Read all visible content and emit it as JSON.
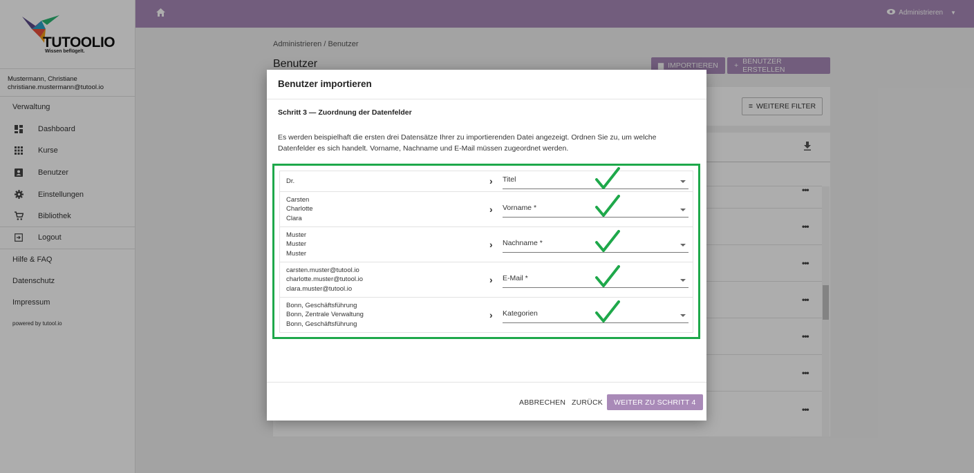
{
  "brand": {
    "name": "TUTOOLIO",
    "tagline": "Wissen beflügelt."
  },
  "user": {
    "name": "Mustermann, Christiane",
    "email": "christiane.mustermann@tutool.io"
  },
  "sidebar": {
    "section_admin": "Verwaltung",
    "items": [
      {
        "label": "Dashboard",
        "icon": "dashboard-icon"
      },
      {
        "label": "Kurse",
        "icon": "grid-icon"
      },
      {
        "label": "Benutzer",
        "icon": "user-icon"
      },
      {
        "label": "Einstellungen",
        "icon": "gear-icon"
      },
      {
        "label": "Bibliothek",
        "icon": "cart-icon"
      },
      {
        "label": "Logout",
        "icon": "logout-icon"
      }
    ],
    "links": [
      "Hilfe & FAQ",
      "Datenschutz",
      "Impressum"
    ],
    "powered": "powered by tutool.io"
  },
  "topbar": {
    "admin_label": "Administrieren"
  },
  "page": {
    "breadcrumb": "Administrieren  /  Benutzer",
    "title": "Benutzer",
    "import_label": "IMPORTIEREN",
    "create_label": "BENUTZER ERSTELLEN",
    "filter_label": "WEITERE FILTER"
  },
  "modal": {
    "title": "Benutzer importieren",
    "step": "Schritt 3 — Zuordnung der Datenfelder",
    "description": "Es werden beispielhaft die ersten drei Datensätze Ihrer zu importierenden Datei angezeigt. Ordnen Sie zu, um welche Datenfelder es sich handelt. Vorname, Nachname und E-Mail müssen zugeordnet werden.",
    "rows": [
      {
        "samples": [
          "Dr."
        ],
        "field": "Titel"
      },
      {
        "samples": [
          "Carsten",
          "Charlotte",
          "Clara"
        ],
        "field": "Vorname *"
      },
      {
        "samples": [
          "Muster",
          "Muster",
          "Muster"
        ],
        "field": "Nachname *"
      },
      {
        "samples": [
          "carsten.muster@tutool.io",
          "charlotte.muster@tutool.io",
          "clara.muster@tutool.io"
        ],
        "field": "E-Mail *"
      },
      {
        "samples": [
          "Bonn, Geschäftsführung",
          "Bonn, Zentrale Verwaltung",
          "Bonn, Geschäftsführung"
        ],
        "field": "Kategorien"
      }
    ],
    "cancel": "ABBRECHEN",
    "back": "ZURÜCK",
    "next": "WEITER ZU SCHRITT 4"
  },
  "colors": {
    "accent": "#a98ab8",
    "highlight": "#1ea84a"
  }
}
